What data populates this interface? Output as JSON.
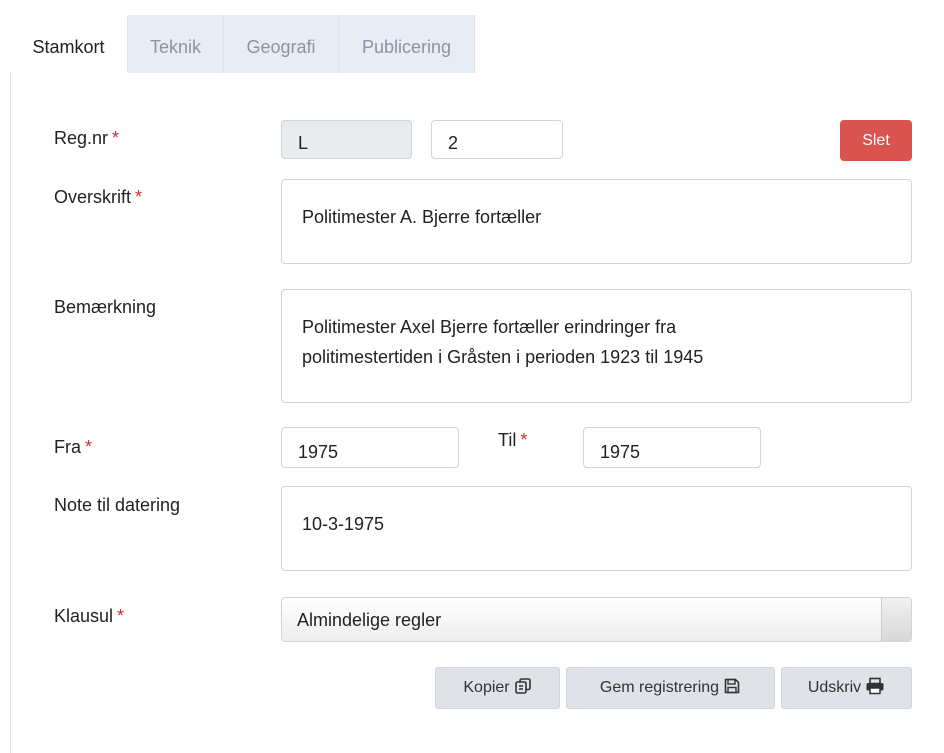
{
  "tabs": [
    {
      "label": "Stamkort",
      "active": true
    },
    {
      "label": "Teknik",
      "active": false
    },
    {
      "label": "Geografi",
      "active": false
    },
    {
      "label": "Publicering",
      "active": false
    }
  ],
  "form": {
    "regnr": {
      "label": "Reg.nr",
      "required": "*",
      "prefix": "L",
      "number": "2"
    },
    "delete_label": "Slet",
    "overskrift": {
      "label": "Overskrift",
      "required": "*",
      "value": "Politimester A. Bjerre fortæller"
    },
    "bemaerkning": {
      "label": "Bemærkning",
      "value": "Politimester Axel Bjerre fortæller erindringer fra politimestertiden i Gråsten i perioden 1923 til 1945"
    },
    "fra": {
      "label": "Fra",
      "required": "*",
      "value": "1975"
    },
    "til": {
      "label": "Til",
      "required": "*",
      "value": "1975"
    },
    "note": {
      "label": "Note til datering",
      "value": "10-3-1975"
    },
    "klausul": {
      "label": "Klausul",
      "required": "*",
      "value": "Almindelige regler"
    }
  },
  "actions": {
    "copy_label": "Kopier",
    "save_label": "Gem registrering",
    "print_label": "Udskriv"
  },
  "colors": {
    "danger": "#d9534f",
    "required": "#c9302c",
    "tab_inactive_bg": "#e8ecf4"
  },
  "icons": [
    "copy-icon",
    "save-icon",
    "print-icon"
  ]
}
